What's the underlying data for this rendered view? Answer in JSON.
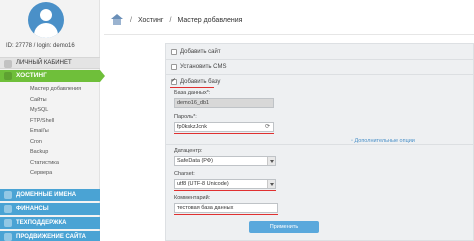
{
  "user": {
    "id_login": "ID: 27778 / login: demo16"
  },
  "sidebar": {
    "cabinet_label": "ЛИЧНЫЙ КАБИНЕТ",
    "hosting_label": "ХОСТИНГ",
    "hosting_items": [
      "Мастер добавления",
      "Сайты",
      "MySQL",
      "FTP/Shell",
      "Email'ы",
      "Cron",
      "Backup",
      "Статистика",
      "Сервера"
    ],
    "sections": [
      {
        "label": "ДОМЕННЫЕ ИМЕНА",
        "color": "#4aa3d4"
      },
      {
        "label": "ФИНАНСЫ",
        "color": "#3f8fc0"
      },
      {
        "label": "ТЕХПОДДЕРЖКА",
        "color": "#3f8fc0"
      },
      {
        "label": "ПРОДВИЖЕНИЕ САЙТА",
        "color": "#3f8fc0"
      }
    ]
  },
  "breadcrumb": {
    "section": "Хостинг",
    "page": "Мастер добавления"
  },
  "options": [
    {
      "label": "Добавить сайт",
      "checked": false
    },
    {
      "label": "Установить CMS",
      "checked": false
    },
    {
      "label": "Добавить базу",
      "checked": true
    }
  ],
  "form": {
    "db_name_label": "База данных*:",
    "db_name_value": "demo16_db1",
    "password_label": "Пароль*:",
    "password_value": "fp0kskzJcnk",
    "advanced_link": "◦ Дополнительные опции",
    "datacenter_label": "Датацентр:",
    "datacenter_value": "SafeData (РФ)",
    "charset_label": "Charset:",
    "charset_value": "utf8 (UTF-8 Unicode)",
    "comment_label": "Комментарий:",
    "comment_value": "тестовая база данных",
    "submit_label": "Применить"
  },
  "colors": {
    "accent_green": "#6fbf3a",
    "accent_blue": "#4aa3d4",
    "highlight_red": "#e03030"
  }
}
